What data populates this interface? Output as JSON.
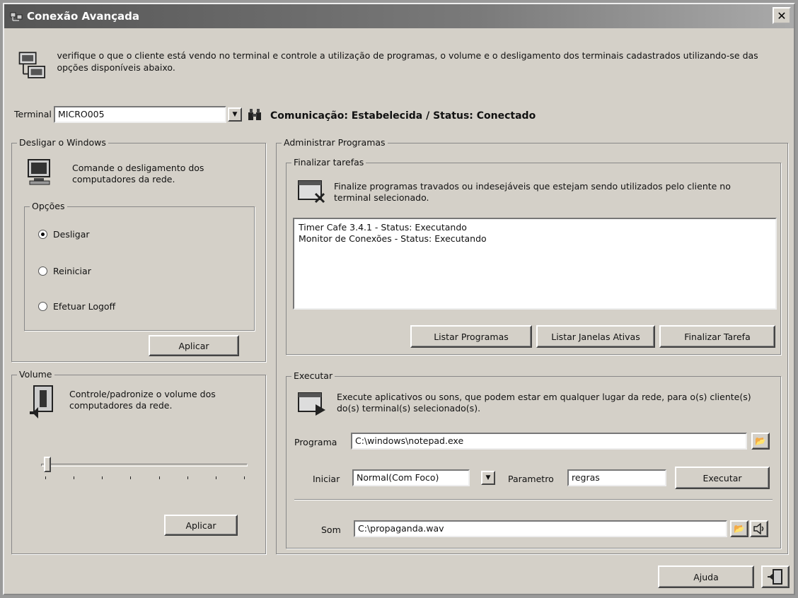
{
  "window": {
    "title": "Conexão Avançada",
    "close": "✕"
  },
  "intro": "verifique o que o cliente está vendo no terminal e controle a utilização de programas, o volume e o desligamento dos terminais cadastrados utilizando-se das opções disponíveis abaixo.",
  "terminal": {
    "label": "Terminal",
    "value": "MICRO005",
    "status": "Comunicação: Estabelecida / Status: Conectado"
  },
  "shutdown": {
    "title": "Desligar o Windows",
    "description": "Comande o desligamento dos computadores da rede.",
    "options_title": "Opções",
    "options": [
      {
        "label": "Desligar",
        "selected": true
      },
      {
        "label": "Reiniciar",
        "selected": false
      },
      {
        "label": "Efetuar Logoff",
        "selected": false
      }
    ],
    "apply": "Aplicar"
  },
  "volume": {
    "title": "Volume",
    "description": "Controle/padronize o volume dos computadores da rede.",
    "level": 0,
    "apply": "Aplicar"
  },
  "programs": {
    "title": "Administrar Programas",
    "finish_tasks": {
      "title": "Finalizar tarefas",
      "description": "Finalize programas travados ou indesejáveis que estejam sendo utilizados pelo cliente no terminal selecionado.",
      "items": [
        "Timer Cafe 3.4.1 - Status: Executando",
        "Monitor de Conexões - Status: Executando"
      ],
      "list_programs": "Listar Programas",
      "list_windows": "Listar Janelas Ativas",
      "finish_task": "Finalizar Tarefa"
    },
    "execute": {
      "title": "Executar",
      "description": "Execute aplicativos ou sons, que podem estar em qualquer lugar da rede, para o(s) cliente(s) do(s) terminal(s) selecionado(s).",
      "program_label": "Programa",
      "program_value": "C:\\windows\\notepad.exe",
      "start_label": "Iniciar",
      "start_value": "Normal(Com Foco)",
      "param_label": "Parametro",
      "param_value": "regras",
      "execute_button": "Executar",
      "sound_label": "Som",
      "sound_value": "C:\\propaganda.wav"
    }
  },
  "help": "Ajuda"
}
